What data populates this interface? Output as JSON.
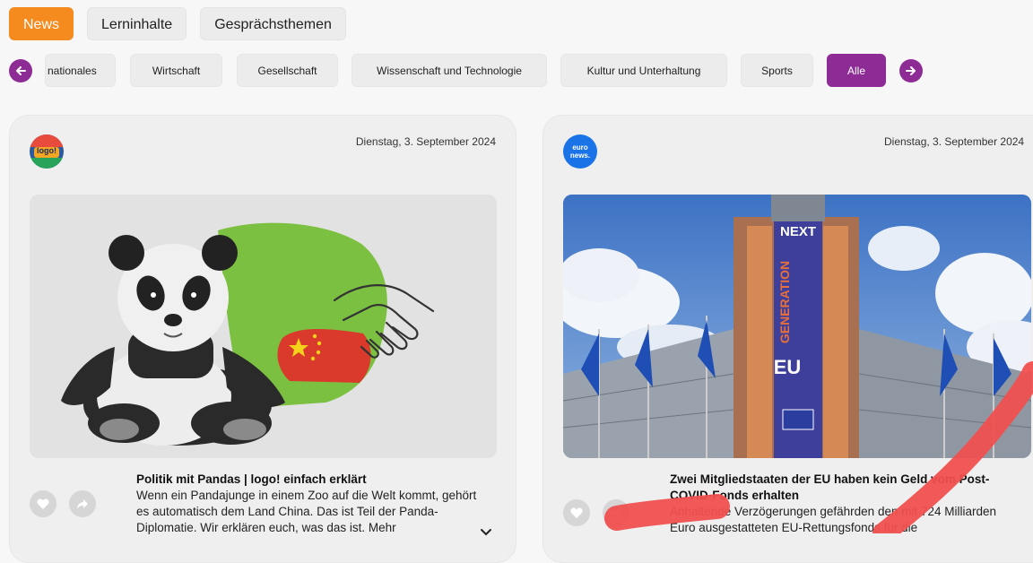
{
  "tabs": [
    {
      "label": "News",
      "active": true
    },
    {
      "label": "Lerninhalte",
      "active": false
    },
    {
      "label": "Gesprächsthemen",
      "active": false
    }
  ],
  "categories": {
    "items": [
      {
        "label": "nationales"
      },
      {
        "label": "Wirtschaft"
      },
      {
        "label": "Gesellschaft"
      },
      {
        "label": "Wissenschaft und Technologie"
      },
      {
        "label": "Kultur und Unterhaltung"
      },
      {
        "label": "Sports"
      },
      {
        "label": "Alle",
        "active": true
      }
    ]
  },
  "cards": [
    {
      "source_logo_text": "logo!",
      "date": "Dienstag, 3. September 2024",
      "title": "Politik mit Pandas | logo! einfach erklärt",
      "teaser": "Wenn ein Pandajunge in einem Zoo auf die Welt kommt, gehört es automatisch dem Land China. Das ist Teil der Panda-Diplomatie. Wir erklären euch, was das ist. Mehr"
    },
    {
      "source_logo_text": "euro news.",
      "date": "Dienstag, 3. September 2024",
      "title": "Zwei Mitgliedstaaten der EU haben kein Geld vom Post-COVID-Fonds erhalten",
      "teaser": "Anhaltende Verzögerungen gefährden den mit 724 Milliarden Euro ausgestatteten EU-Rettungsfonds für die",
      "banner_text": [
        "NEXT",
        "GENERATION",
        "EU"
      ]
    }
  ],
  "colors": {
    "accent_orange": "#f58a1f",
    "accent_purple": "#8e2c96"
  }
}
